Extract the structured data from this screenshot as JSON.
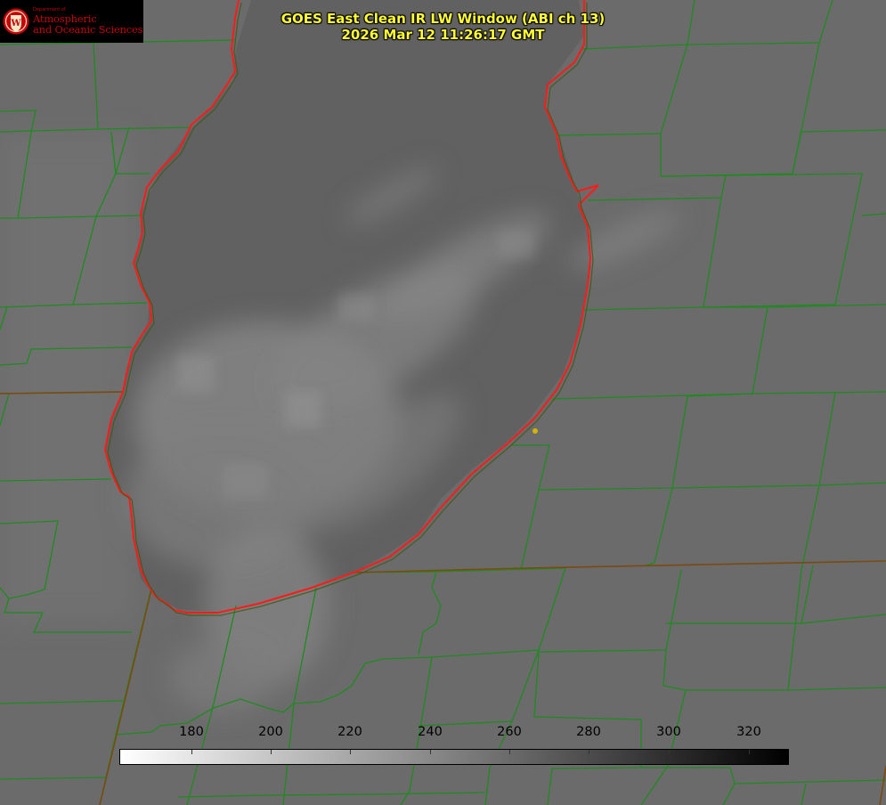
{
  "logo": {
    "department": "Department of",
    "line1": "Atmospheric",
    "line2": "and Oceanic Sciences",
    "seal_letter": "W",
    "seal_color": "#c5050c"
  },
  "title": {
    "line1": "GOES East Clean IR LW Window (ABI ch 13)",
    "line2": "2026 Mar 12 11:26:17 GMT"
  },
  "colorbar": {
    "ticks": [
      "180",
      "200",
      "220",
      "240",
      "260",
      "280",
      "300",
      "320"
    ],
    "gradient_start": "#ffffff",
    "gradient_end": "#000000"
  },
  "colors": {
    "background": "#6a6a6a",
    "county_lines": "#1f8a1f",
    "lake_outline": "#ff1a1a",
    "marker": "#d4b400",
    "title": "#ffff33"
  }
}
